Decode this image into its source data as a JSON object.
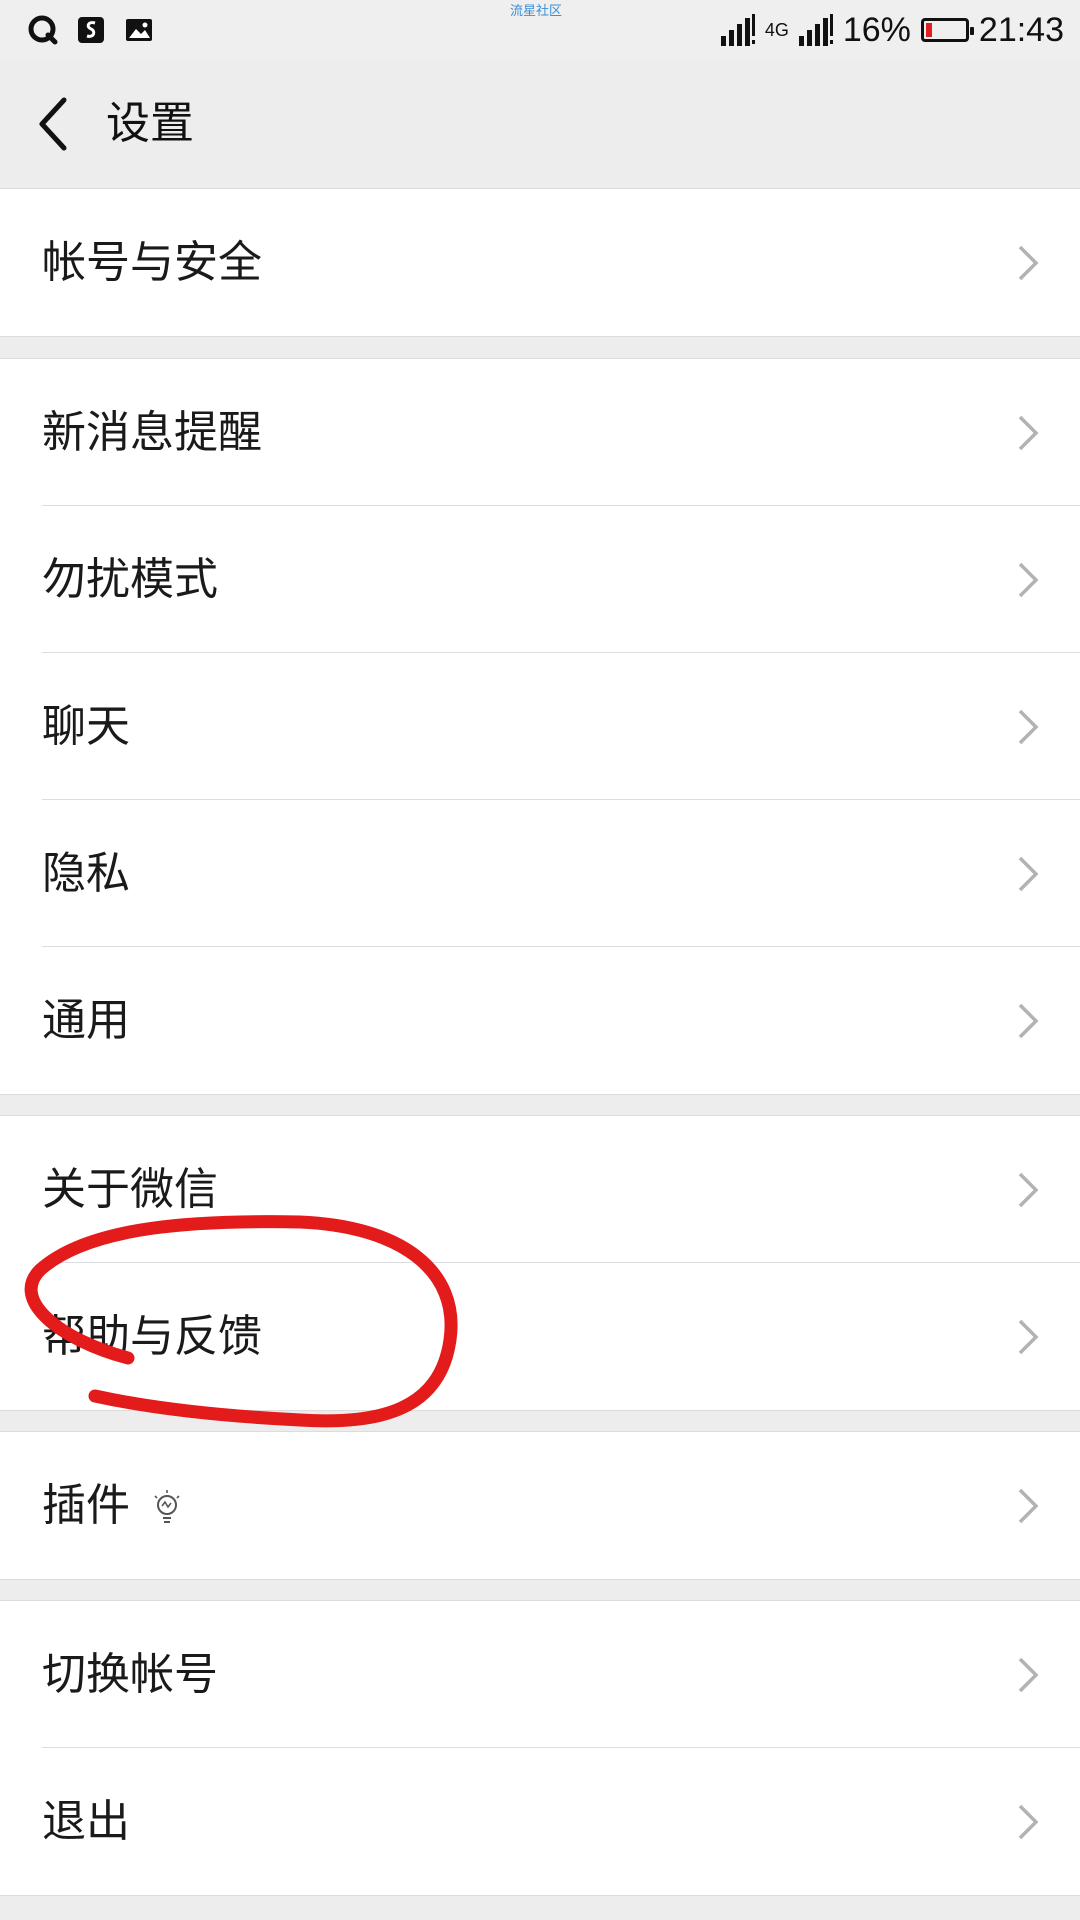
{
  "status_bar": {
    "left_icons": [
      "qq-icon",
      "notification-app-icon",
      "gallery-icon"
    ],
    "watermark": "流星社区",
    "network": "4G",
    "battery_percent": "16%",
    "battery_level": 0.16,
    "time": "21:43"
  },
  "header": {
    "title": "设置",
    "back_icon": "chevron-left-icon"
  },
  "groups": [
    {
      "items": [
        {
          "label": "帐号与安全"
        }
      ]
    },
    {
      "items": [
        {
          "label": "新消息提醒"
        },
        {
          "label": "勿扰模式"
        },
        {
          "label": "聊天"
        },
        {
          "label": "隐私"
        },
        {
          "label": "通用"
        }
      ]
    },
    {
      "items": [
        {
          "label": "关于微信"
        },
        {
          "label": "帮助与反馈"
        }
      ]
    },
    {
      "items": [
        {
          "label": "插件",
          "badge_icon": "lightbulb-icon"
        }
      ]
    },
    {
      "items": [
        {
          "label": "切换帐号"
        },
        {
          "label": "退出"
        }
      ]
    }
  ],
  "colors": {
    "background": "#ededed",
    "list_background": "#ffffff",
    "annotation_red": "#e31b1b"
  }
}
